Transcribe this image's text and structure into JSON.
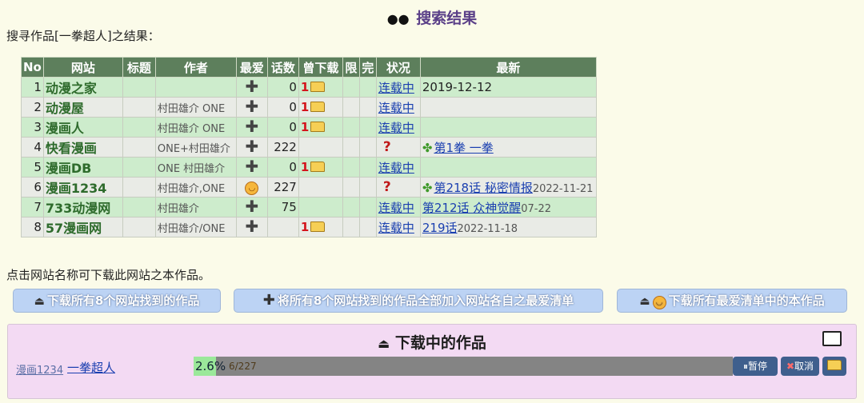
{
  "header": {
    "icon": "eyes-icon",
    "title": "搜索结果"
  },
  "query_line": "搜寻作品[一拳超人]之结果：",
  "table": {
    "columns": [
      "No",
      "网站",
      "标题",
      "作者",
      "最爱",
      "话数",
      "曾下载",
      "限",
      "完",
      "状况",
      "最新"
    ],
    "rows": [
      {
        "no": "1",
        "site": "动漫之家",
        "author": "",
        "fav": "plus",
        "eps": "0",
        "dl_count": "1",
        "status": "连载中",
        "latest": "2019-12-12",
        "latest_date": ""
      },
      {
        "no": "2",
        "site": "动漫屋",
        "author": "村田雄介 ONE",
        "fav": "plus",
        "eps": "0",
        "dl_count": "1",
        "status": "连载中",
        "latest": "",
        "latest_date": ""
      },
      {
        "no": "3",
        "site": "漫画人",
        "author": "村田雄介 ONE",
        "fav": "plus",
        "eps": "0",
        "dl_count": "1",
        "status": "连载中",
        "latest": "",
        "latest_date": ""
      },
      {
        "no": "4",
        "site": "快看漫画",
        "author": "ONE+村田雄介",
        "fav": "plus",
        "eps": "222",
        "dl_count": "",
        "status": "?",
        "latest": "第1拳 一拳",
        "latest_date": ""
      },
      {
        "no": "5",
        "site": "漫画DB",
        "author": "ONE 村田雄介",
        "fav": "plus",
        "eps": "0",
        "dl_count": "1",
        "status": "连载中",
        "latest": "",
        "latest_date": ""
      },
      {
        "no": "6",
        "site": "漫画1234",
        "author": "村田雄介,ONE",
        "fav": "smile",
        "eps": "227",
        "dl_count": "",
        "status": "?",
        "latest": "第218话 秘密情报",
        "latest_date": "2022-11-21"
      },
      {
        "no": "7",
        "site": "733动漫网",
        "author": "村田雄介",
        "fav": "plus",
        "eps": "75",
        "dl_count": "",
        "status": "连载中",
        "latest": "第212话 众神觉醒",
        "latest_date": "07-22"
      },
      {
        "no": "8",
        "site": "57漫画网",
        "author": "村田雄介/ONE",
        "fav": "plus",
        "eps": "",
        "dl_count": "1",
        "status": "连载中",
        "latest": "219话",
        "latest_date": "2022-11-18"
      }
    ]
  },
  "note": "点击网站名称可下载此网站之本作品。",
  "actions": {
    "download_all": "下载所有8个网站找到的作品",
    "add_all_fav": "将所有8个网站找到的作品全部加入网站各自之最爱清单",
    "download_fav": "下载所有最爱清单中的本作品"
  },
  "downloads": {
    "title": "下载中的作品",
    "item": {
      "site": "漫画1234",
      "work": "一拳超人",
      "percent_text": "2.6%",
      "count": "6/227",
      "progress": 0.026,
      "pause": "暂停",
      "cancel": "取消"
    }
  },
  "colors": {
    "header_green": "#5d7f5c",
    "row_green": "#cdeccc",
    "row_gray": "#e9ebe6",
    "button_blue": "#bcd3f4",
    "panel_pink": "#f3daf3"
  }
}
